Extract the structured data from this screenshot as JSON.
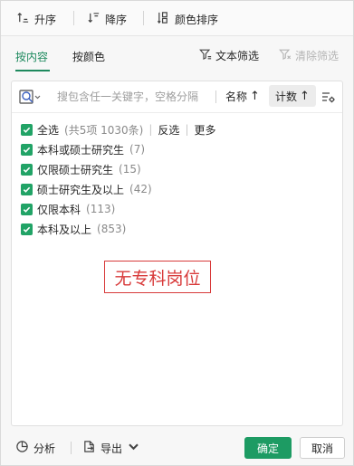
{
  "sort": {
    "asc_label": "升序",
    "desc_label": "降序",
    "color_label": "颜色排序"
  },
  "tabs": [
    {
      "label": "按内容",
      "active": true
    },
    {
      "label": "按颜色",
      "active": false
    }
  ],
  "filters": {
    "text_filter_label": "文本筛选",
    "clear_filter_label": "清除筛选"
  },
  "search": {
    "placeholder": "搜包含任一关键字，空格分隔",
    "value": "",
    "name_sort_label": "名称",
    "count_sort_label": "计数",
    "arrow": "↑"
  },
  "list": {
    "select_all_label": "全选",
    "select_all_count": "(共5项 1030条)",
    "invert_label": "反选",
    "more_label": "更多",
    "items": [
      {
        "label": "本科或硕士研究生",
        "count": "(7)"
      },
      {
        "label": "仅限硕士研究生",
        "count": "(15)"
      },
      {
        "label": "硕士研究生及以上",
        "count": "(42)"
      },
      {
        "label": "仅限本科",
        "count": "(113)"
      },
      {
        "label": "本科及以上",
        "count": "(853)"
      }
    ]
  },
  "annotation": "无专科岗位",
  "footer": {
    "analyze_label": "分析",
    "export_label": "导出",
    "ok_label": "确定",
    "cancel_label": "取消"
  },
  "colors": {
    "accent": "#1e8a5e",
    "checkbox": "#21a366",
    "primary_button": "#1d9b63",
    "annotation": "#d83a3a"
  },
  "icons": [
    "sort-asc-icon",
    "sort-desc-icon",
    "color-sort-icon",
    "filter-icon",
    "clear-filter-icon",
    "search-scope-icon",
    "list-options-icon",
    "check-icon",
    "analyze-icon",
    "export-icon",
    "chevron-down-icon"
  ]
}
